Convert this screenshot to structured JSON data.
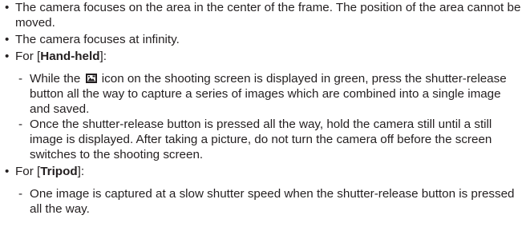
{
  "bullet_glyph": "•",
  "dash_glyph": "-",
  "items": {
    "focus_area": "The camera focuses on the area in the center of the frame. The position of the area cannot be moved.",
    "focus_infinity": "The camera focuses at infinity.",
    "handheld": {
      "prefix": "For [",
      "name": "Hand-held",
      "suffix": "]:",
      "sub1_before_icon": "While the",
      "icon": "hand-held-mode-icon",
      "sub1_after_icon": "icon on the shooting screen is displayed in green, press the shutter-release button all the way to capture a series of images which are combined into a single image and saved.",
      "sub2": "Once the shutter-release button is pressed all the way, hold the camera still until a still image is displayed. After taking a picture, do not turn the camera off before the screen switches to the shooting screen."
    },
    "tripod": {
      "prefix": "For [",
      "name": "Tripod",
      "suffix": "]:",
      "sub1": "One image is captured at a slow shutter speed when the shutter-release button is pressed all the way."
    }
  }
}
